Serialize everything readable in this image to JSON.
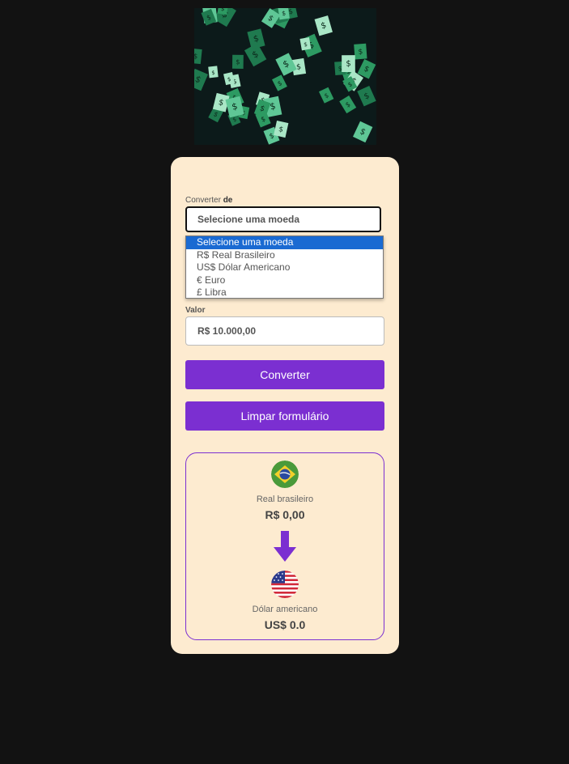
{
  "hero": {
    "icon": "falling-money-image"
  },
  "form": {
    "from_label_prefix": "Converter ",
    "from_label_bold": "de",
    "select_value": "Selecione uma moeda",
    "dropdown_options": [
      "Selecione uma moeda",
      "R$ Real Brasileiro",
      "US$ Dólar Americano",
      "€ Euro",
      "£ Libra"
    ],
    "value_label": "Valor",
    "value_placeholder": "R$ 10.000,00",
    "convert_button": "Converter",
    "clear_button": "Limpar formulário"
  },
  "result": {
    "from_currency": {
      "flag_icon": "brazil-flag-icon",
      "name": "Real brasileiro",
      "amount": "R$ 0,00"
    },
    "arrow_icon": "arrow-down-icon",
    "to_currency": {
      "flag_icon": "usa-flag-icon",
      "name": "Dólar americano",
      "amount": "US$ 0.0"
    }
  },
  "colors": {
    "background": "#121212",
    "card": "#fdebd0",
    "accent": "#7b2fd1",
    "selected_option": "#1a6ad2"
  }
}
